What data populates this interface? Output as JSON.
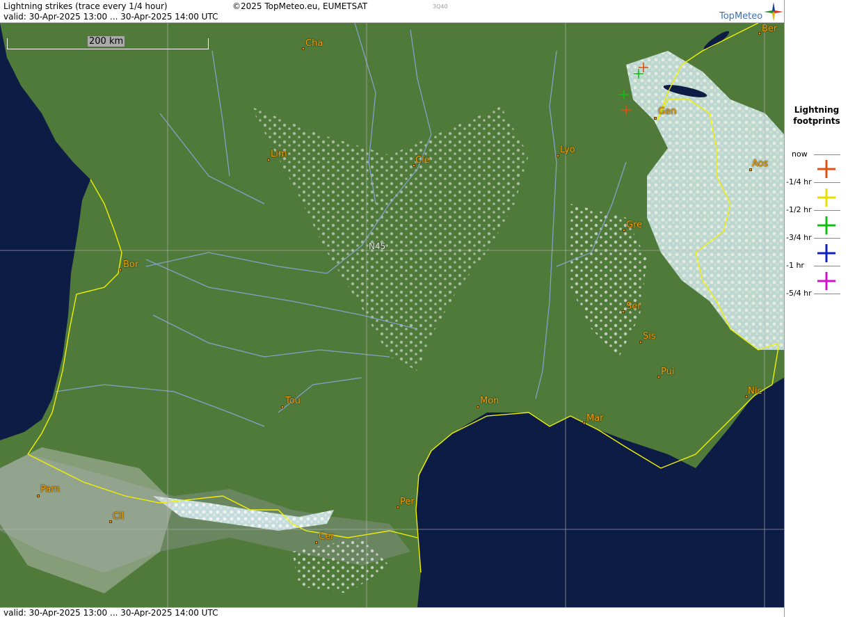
{
  "header": {
    "title": "Lightning strikes (trace every 1/4 hour)",
    "valid": "valid:  30-Apr-2025 13:00 ... 30-Apr-2025 14:00 UTC",
    "copyright": "©2025 TopMeteo.eu, EUMETSAT",
    "code": "3Q40",
    "brand": "TopMeteo"
  },
  "footer": {
    "valid": "valid:  30-Apr-2025 13:00 ... 30-Apr-2025 14:00 UTC"
  },
  "map": {
    "scale_label": "200 km",
    "latitude_label": "N45",
    "colors": {
      "land": "#4f7a3a",
      "sea": "#0c1c44",
      "border": "#f0f000",
      "river": "#8aa6d8",
      "grid": "#b9b9b9"
    },
    "cities": [
      {
        "name": "Cha"
      },
      {
        "name": "Ber"
      },
      {
        "name": "Gen"
      },
      {
        "name": "Lim"
      },
      {
        "name": "Cle"
      },
      {
        "name": "Lyo"
      },
      {
        "name": "Aos"
      },
      {
        "name": "Gre"
      },
      {
        "name": "Bor"
      },
      {
        "name": "Ser"
      },
      {
        "name": "Sis"
      },
      {
        "name": "Pui"
      },
      {
        "name": "Tou"
      },
      {
        "name": "Mon"
      },
      {
        "name": "Mar"
      },
      {
        "name": "Nic"
      },
      {
        "name": "Pam"
      },
      {
        "name": "Cil"
      },
      {
        "name": "Per"
      },
      {
        "name": "Cer"
      }
    ],
    "strikes": [
      {
        "age": "now"
      },
      {
        "age": "-3/4 hr"
      },
      {
        "age": "-3/4 hr"
      },
      {
        "age": "now"
      }
    ]
  },
  "legend": {
    "title_line1": "Lightning",
    "title_line2": "footprints",
    "items": [
      {
        "label": "now",
        "color": "#e05010"
      },
      {
        "label": "-1/4 hr",
        "color": "#e8e000"
      },
      {
        "label": "-1/2 hr",
        "color": "#10c010"
      },
      {
        "label": "-3/4 hr",
        "color": "#1020c0"
      },
      {
        "label": "-1 hr",
        "color": "#d010d0"
      },
      {
        "label": "-5/4 hr",
        "color": ""
      }
    ]
  }
}
